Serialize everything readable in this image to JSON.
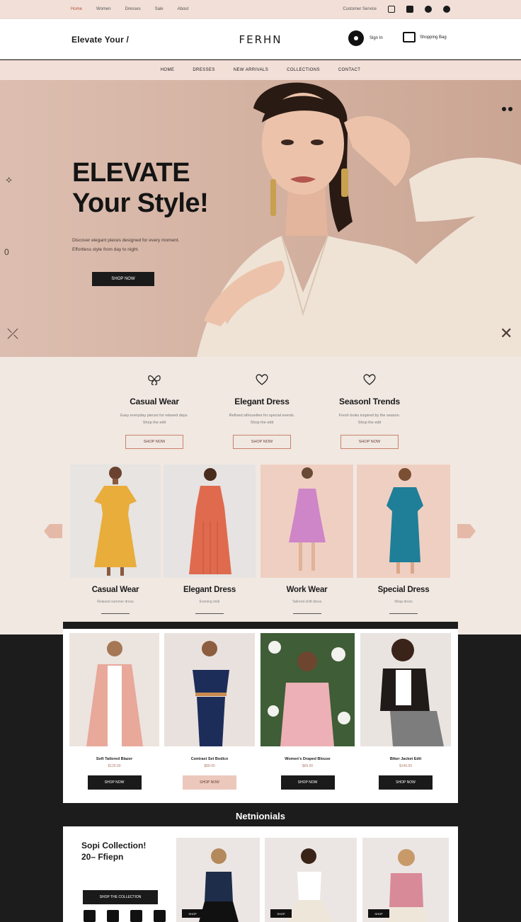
{
  "topbar": {
    "links": [
      "Home",
      "Women",
      "Dresses",
      "Sale",
      "About"
    ],
    "right_text": "Customer Service"
  },
  "header": {
    "tagline": "Elevate Your /",
    "logo": "FERHN",
    "account_label": "Sign In",
    "bag_label": "Shopping Bag"
  },
  "nav": {
    "items": [
      "HOME",
      "DRESSES",
      "NEW ARRIVALS",
      "COLLECTIONS",
      "CONTACT"
    ]
  },
  "hero": {
    "title_line1": "ELEVATE",
    "title_line2": "Your Style!",
    "subtitle_line1": "Discover elegant pieces designed for every moment.",
    "subtitle_line2": "Effortless style from day to night.",
    "cta": "SHOP NOW"
  },
  "categories": [
    {
      "title": "Casual Wear",
      "desc_line1": "Easy everyday pieces for relaxed days.",
      "desc_line2": "Shop the edit",
      "button": "SHOP NOW"
    },
    {
      "title": "Elegant Dress",
      "desc_line1": "Refined silhouettes for special events.",
      "desc_line2": "Shop the edit",
      "button": "SHOP NOW"
    },
    {
      "title": "Seasonl Trends",
      "desc_line1": "Fresh looks inspired by the season.",
      "desc_line2": "Shop the edit",
      "button": "SHOP NOW"
    }
  ],
  "carousel": [
    {
      "title": "Casual Wear",
      "desc": "Relaxed summer dress"
    },
    {
      "title": "Elegant Dress",
      "desc": "Evening midi"
    },
    {
      "title": "Work Wear",
      "desc": "Tailored shift dress"
    },
    {
      "title": "Special Dress",
      "desc": "Wrap dress"
    }
  ],
  "products": [
    {
      "caption": "Soft Tailored Blazer",
      "price": "$129.00",
      "button": "SHOP NOW"
    },
    {
      "caption": "Contrast Set Bodice",
      "price": "$89.00",
      "button": "SHOP NOW"
    },
    {
      "caption": "Women's Draped Blouse",
      "price": "$69.00",
      "button": "SHOP NOW"
    },
    {
      "caption": "Biker Jacket Edit",
      "price": "$149.00",
      "button": "SHOP NOW"
    }
  ],
  "testimonials": {
    "title": "Netnionials",
    "heading_line1": "Sopi Collection!",
    "heading_line2": "20– Ffiepn",
    "button": "SHOP THE COLLECTION",
    "card_chip": "SHOP"
  },
  "colors": {
    "blush": "#f1dfd8",
    "dark": "#1c1c1c",
    "accent": "#c9826a"
  }
}
